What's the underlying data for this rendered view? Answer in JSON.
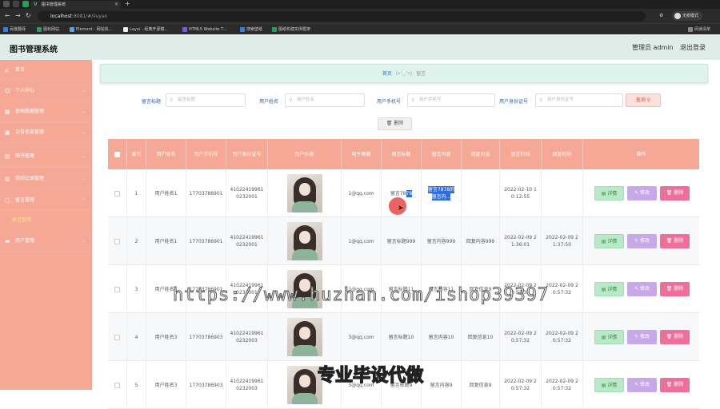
{
  "browser": {
    "tab_title": "图书管理系统",
    "url_host": "localhost",
    "url_path": ":8081/#/liuyan",
    "profile_label": "无痕模式",
    "bookmarks": [
      "百度翻译",
      "图标网站",
      "Element - 网站快...",
      "Layui - 经典开源模...",
      "HTML5 Website T...",
      "搜索壁纸",
      "图纸构建实例框架",
      "阅读清单"
    ]
  },
  "header": {
    "title": "图书管理系统",
    "user": "管理员 admin",
    "logout": "退出登录"
  },
  "sidebar": {
    "items": [
      {
        "label": "首页",
        "icon": "home-icon"
      },
      {
        "label": "个人中心",
        "icon": "user-icon"
      },
      {
        "label": "基础数据管理",
        "icon": "grid-icon"
      },
      {
        "label": "公告信息管理",
        "icon": "notice-icon"
      },
      {
        "label": "图书管理",
        "icon": "book-icon"
      },
      {
        "label": "借阅记录管理",
        "icon": "record-icon"
      },
      {
        "label": "留言管理",
        "icon": "message-icon"
      },
      {
        "label": "用户管理",
        "icon": "users-icon"
      }
    ],
    "sub_active": "留言管理"
  },
  "breadcrumb": {
    "home": "首页",
    "emoticon": "(•'◡'•)",
    "current": "留言"
  },
  "search": {
    "fields": [
      {
        "label": "留言标题",
        "placeholder": "留言标题"
      },
      {
        "label": "用户姓名",
        "placeholder": "用户姓名"
      },
      {
        "label": "用户手机号",
        "placeholder": "用户手机号"
      },
      {
        "label": "用户身份证号",
        "placeholder": "用户身份证号"
      }
    ],
    "query_label": "查询 ⚲",
    "delete_label": "🗑 删除"
  },
  "table": {
    "headers": [
      "索引",
      "用户姓名",
      "用户手机号",
      "用户身份证号",
      "用户头像",
      "电子邮箱",
      "留言标题",
      "留言内容",
      "回复内容",
      "留言时间",
      "回复时间",
      "操作"
    ],
    "rows": [
      {
        "index": "1",
        "name": "用户姓名1",
        "phone": "17703786901",
        "idcard": "410224199610232001",
        "email": "1@qq.com",
        "title_a": "留言78",
        "title_b": "78",
        "content_a": "留言7878的",
        "content_b": "留言内...",
        "reply": "",
        "time": "2022-02-10 10:12:55",
        "reply_time": ""
      },
      {
        "index": "2",
        "name": "用户姓名1",
        "phone": "17703786901",
        "idcard": "410224199610232001",
        "email": "1@qq.com",
        "title_a": "留言标题999",
        "title_b": "",
        "content_a": "留言内容999",
        "content_b": "",
        "reply": "回复内容999",
        "time": "2022-02-09 21:36:01",
        "reply_time": "2022-02-09 21:37:50"
      },
      {
        "index": "3",
        "name": "用户姓名1",
        "phone": "17703786901",
        "idcard": "410224199610232001",
        "email": "1@qq.com",
        "title_a": "留言标题11",
        "title_b": "",
        "content_a": "留言内容11",
        "content_b": "",
        "reply": "回复信息9",
        "time": "2022-02-09 20:57:32",
        "reply_time": "2022-02-09 20:57:32"
      },
      {
        "index": "4",
        "name": "用户姓名3",
        "phone": "17703786903",
        "idcard": "410224199610232003",
        "email": "3@qq.com",
        "title_a": "留言标题10",
        "title_b": "",
        "content_a": "留言内容10",
        "content_b": "",
        "reply": "回复信息10",
        "time": "2022-02-09 20:57:32",
        "reply_time": "2022-02-09 20:57:32"
      },
      {
        "index": "5",
        "name": "用户姓名3",
        "phone": "17703786903",
        "idcard": "410224199610232003",
        "email": "3@qq.com",
        "title_a": "留言标题9",
        "title_b": "",
        "content_a": "留言内容9",
        "content_b": "",
        "reply": "回复信息9",
        "time": "2022-02-09 20:57:32",
        "reply_time": "2022-02-09 20:57:32"
      }
    ],
    "actions": {
      "view": "▤ 详情",
      "edit": "✎ 修改",
      "delete": "🗑 删除"
    }
  },
  "watermarks": {
    "url": "https://www.huzhan.com/ishop39397",
    "slogan": "专业毕设代做"
  },
  "colors": {
    "sidebar": "#f4a895",
    "header": "#dfede8",
    "view_button": "#b9e9c6",
    "edit_button": "#c7a8e8",
    "delete_button": "#ef6f9a"
  }
}
